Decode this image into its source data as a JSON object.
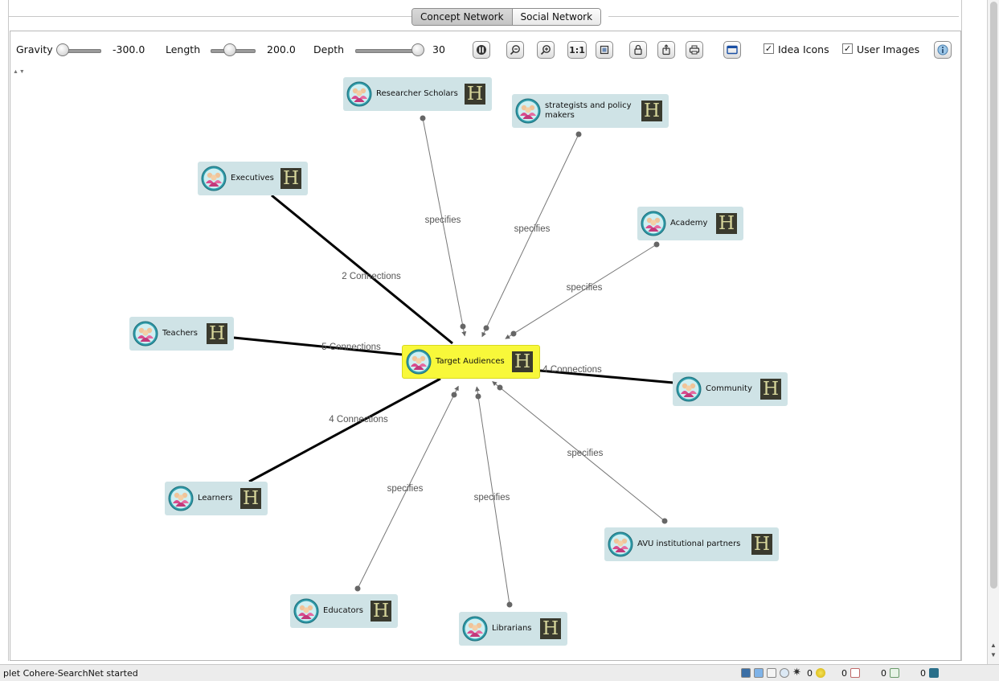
{
  "tabs": [
    {
      "label": "Concept Network",
      "active": true
    },
    {
      "label": "Social Network",
      "active": false
    }
  ],
  "toolbar": {
    "gravity_label": "Gravity",
    "gravity_value": "-300.0",
    "length_label": "Length",
    "length_value": "200.0",
    "depth_label": "Depth",
    "depth_value": "30",
    "fit_button": "1:1",
    "idea_icons_label": "Idea Icons",
    "idea_icons_checked": true,
    "user_images_label": "User Images",
    "user_images_checked": true,
    "icons": [
      "pause-icon",
      "zoom-out-icon",
      "zoom-in-icon",
      "actual-size-icon",
      "page-icon",
      "lock-icon",
      "export-icon",
      "print-icon",
      "window-icon",
      "info-icon"
    ]
  },
  "graph": {
    "badge_letter": "H",
    "center": {
      "label": "Target Audiences",
      "color": "#f8f83a"
    },
    "nodes": [
      {
        "id": "researcher-scholars",
        "label": "Researcher Scholars"
      },
      {
        "id": "strategists",
        "label": "strategists and policy makers"
      },
      {
        "id": "executives",
        "label": "Executives"
      },
      {
        "id": "academy",
        "label": "Academy"
      },
      {
        "id": "teachers",
        "label": "Teachers"
      },
      {
        "id": "community",
        "label": "Community"
      },
      {
        "id": "learners",
        "label": "Learners"
      },
      {
        "id": "avu-partners",
        "label": "AVU institutional partners"
      },
      {
        "id": "educators",
        "label": "Educators"
      },
      {
        "id": "librarians",
        "label": "Librarians"
      }
    ],
    "edges": [
      {
        "from": "researcher-scholars",
        "label": "specifies",
        "type": "arrow"
      },
      {
        "from": "strategists",
        "label": "specifies",
        "type": "arrow"
      },
      {
        "from": "executives",
        "label": "2 Connections",
        "type": "bold"
      },
      {
        "from": "academy",
        "label": "specifies",
        "type": "arrow"
      },
      {
        "from": "teachers",
        "label": "5 Connections",
        "type": "bold"
      },
      {
        "from": "community",
        "label": "4 Connections",
        "type": "bold"
      },
      {
        "from": "learners",
        "label": "4 Connections",
        "type": "bold"
      },
      {
        "from": "avu-partners",
        "label": "specifies",
        "type": "arrow"
      },
      {
        "from": "educators",
        "label": "specifies",
        "type": "arrow"
      },
      {
        "from": "librarians",
        "label": "specifies",
        "type": "arrow"
      }
    ]
  },
  "status": {
    "text": "plet Cohere-SearchNet started",
    "ideas_count": "0",
    "docs_count": "0",
    "lists_count": "0",
    "net_count": "0"
  },
  "colors": {
    "node_bg": "#cfe3e6",
    "center_bg": "#f8f83a",
    "badge_bg": "#3a3a2e",
    "badge_fg": "#d6d59a"
  }
}
